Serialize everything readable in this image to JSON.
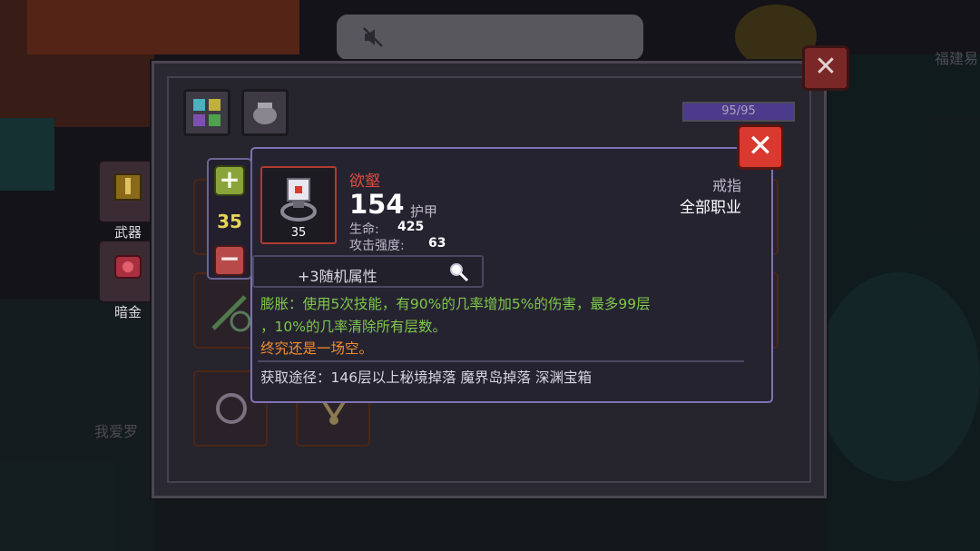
{
  "background": {
    "left_label_1": "武器",
    "left_label_2": "暗金",
    "player_name": "我爱罗",
    "corner_text": "福建易"
  },
  "panel": {
    "hp_text": "95/95",
    "hp_fraction": 1.0,
    "close_symbol": "✕"
  },
  "quantity": {
    "plus_symbol": "+",
    "value": "35",
    "minus_symbol": "−"
  },
  "item": {
    "name": "欲壑",
    "value": "154",
    "value_label": "护甲",
    "level": "35",
    "type": "戒指",
    "class_restriction": "全部职业",
    "stats": [
      {
        "label": "生命:",
        "value": "425"
      },
      {
        "label": "攻击强度:",
        "value": "63"
      }
    ],
    "random_attributes": "+3随机属性",
    "effect_line_1": "膨胀：使用5次技能，有90%的几率增加5%的伤害，最多99层",
    "effect_line_2": "，10%的几率清除所有层数。",
    "flavor": "终究还是一场空。",
    "source": "获取途径：146层以上秘境掉落 魔界岛掉落 深渊宝箱",
    "close_symbol": "✕"
  },
  "colors": {
    "name_red": "#e14b3e",
    "effect_green": "#7ec94a",
    "flavor_orange": "#f08c2c",
    "qty_yellow": "#e6d55a",
    "close_red": "#d9392f"
  }
}
